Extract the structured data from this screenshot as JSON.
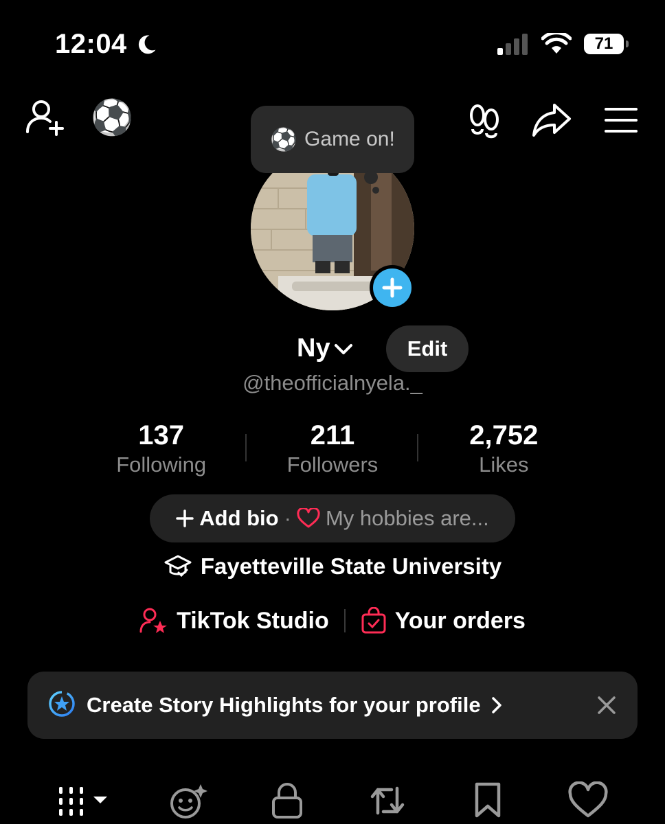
{
  "status_bar": {
    "time": "12:04",
    "battery": "71"
  },
  "tooltip": {
    "text": "Game on!"
  },
  "profile": {
    "name": "Ny",
    "edit_label": "Edit",
    "handle": "@theofficialnyela._"
  },
  "stats": [
    {
      "value": "137",
      "label": "Following"
    },
    {
      "value": "211",
      "label": "Followers"
    },
    {
      "value": "2,752",
      "label": "Likes"
    }
  ],
  "bio": {
    "add_label": "Add bio",
    "separator": "·",
    "hint": "My hobbies are..."
  },
  "school": "Fayetteville State University",
  "links": {
    "studio": "TikTok Studio",
    "orders": "Your orders"
  },
  "banner": {
    "text": "Create Story Highlights for your profile"
  },
  "icons": {
    "accent_blue": "#3fb5f0",
    "accent_red": "#fe2c55"
  }
}
